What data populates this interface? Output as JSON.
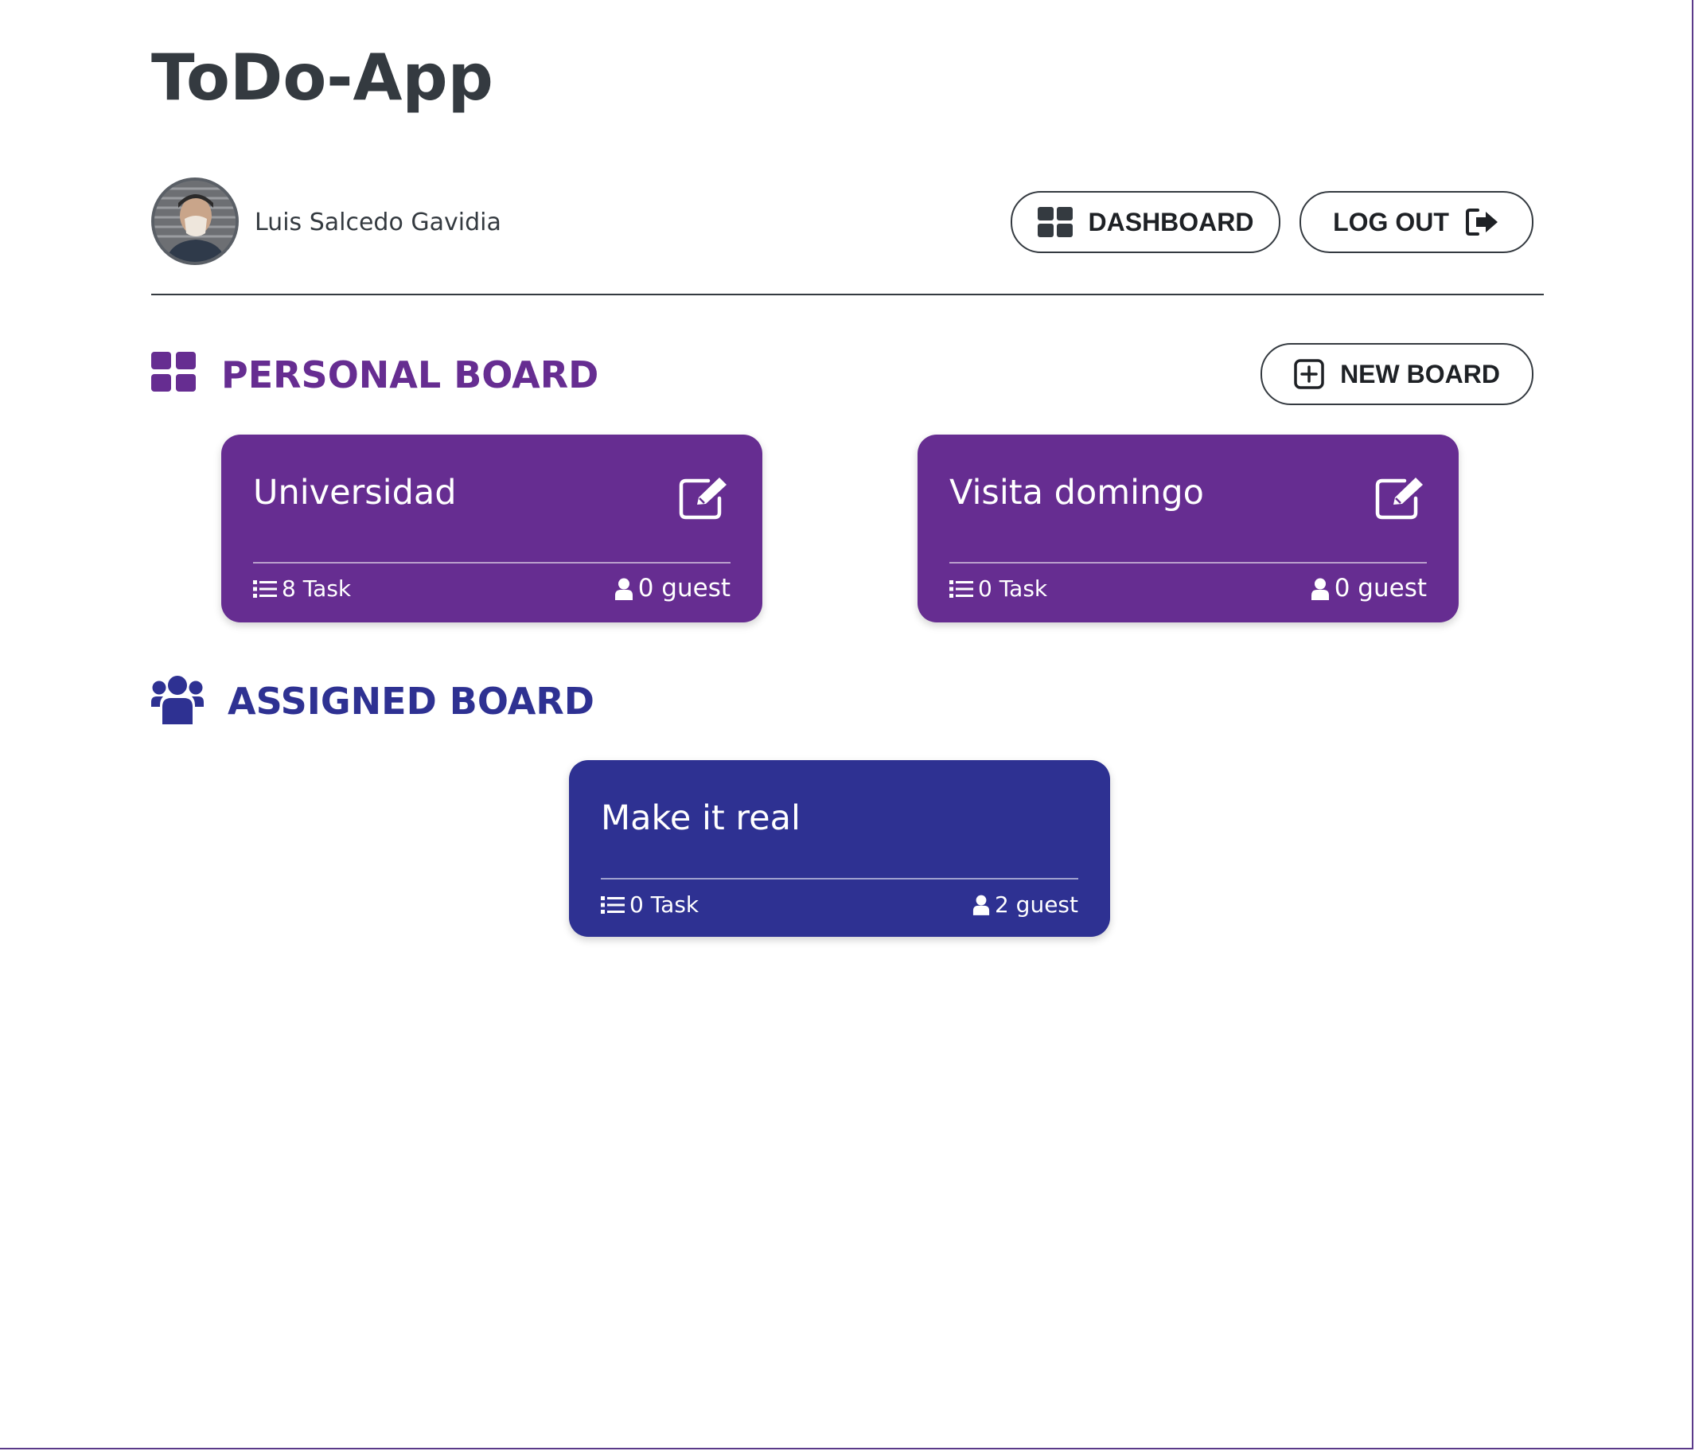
{
  "header": {
    "title": "ToDo-App"
  },
  "user": {
    "name": "Luis Salcedo Gavidia",
    "avatar": "profile-photo"
  },
  "nav": {
    "dashboard_label": "DASHBOARD",
    "dashboard_icon": "grid-icon",
    "logout_label": "LOG OUT",
    "logout_icon": "sign-out-icon"
  },
  "personal": {
    "title": "PERSONAL BOARD",
    "icon": "grid-icon",
    "color": "#662d91",
    "new_board_label": "NEW BOARD",
    "new_board_icon": "plus-square-icon",
    "boards": [
      {
        "name": "Universidad",
        "tasks": "8 Task",
        "guests": "0 guest"
      },
      {
        "name": "Visita domingo",
        "tasks": "0 Task",
        "guests": "0 guest"
      }
    ]
  },
  "assigned": {
    "title": "ASSIGNED BOARD",
    "icon": "users-icon",
    "color": "#2e3192",
    "boards": [
      {
        "name": "Make it real",
        "tasks": "0 Task",
        "guests": "2 guest"
      }
    ]
  },
  "colors": {
    "text": "#343a40",
    "personal_card": "#662d91",
    "assigned_card": "#2e3192"
  }
}
